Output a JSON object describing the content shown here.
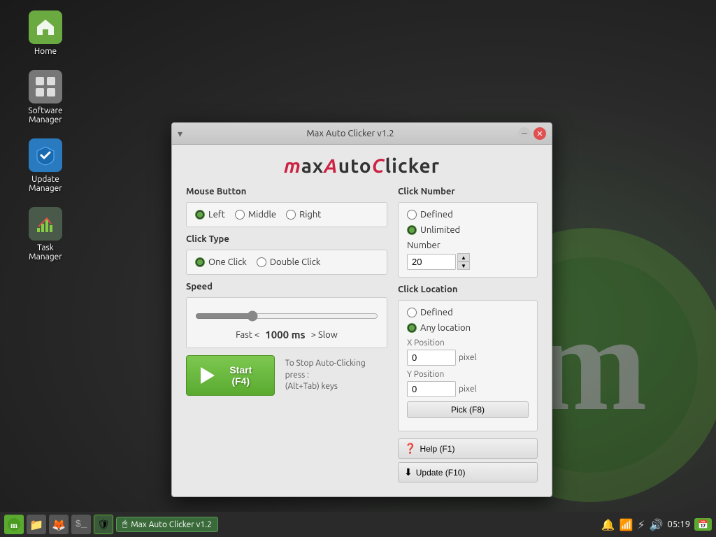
{
  "desktop": {
    "icons": [
      {
        "id": "home",
        "label": "Home",
        "icon_color": "#6aaa40",
        "icon_symbol": "🏠"
      },
      {
        "id": "software-manager",
        "label": "Software\nManager",
        "icon_color": "#888888",
        "icon_symbol": "⊞"
      },
      {
        "id": "update-manager",
        "label": "Update\nManager",
        "icon_color": "#2a7abf",
        "icon_symbol": "🛡"
      },
      {
        "id": "task-manager",
        "label": "Task\nManager",
        "icon_color": "#556655",
        "icon_symbol": "📊"
      }
    ]
  },
  "window": {
    "title": "Max Auto Clicker v1.2",
    "logo_text": "MaxAutoClicker",
    "sections": {
      "mouse_button": {
        "label": "Mouse Button",
        "options": [
          "Left",
          "Middle",
          "Right"
        ],
        "selected": "Left"
      },
      "click_type": {
        "label": "Click Type",
        "options": [
          "One Click",
          "Double Click"
        ],
        "selected": "One Click"
      },
      "speed": {
        "label": "Speed",
        "fast_label": "Fast <",
        "slow_label": "> Slow",
        "value": "1000 ms",
        "slider_value": 30
      },
      "click_number": {
        "label": "Click Number",
        "options": [
          "Defined",
          "Unlimited"
        ],
        "selected": "Unlimited",
        "number_label": "Number",
        "number_value": "20"
      },
      "click_location": {
        "label": "Click Location",
        "options": [
          "Defined",
          "Any location"
        ],
        "selected": "Any location",
        "x_label": "X Position",
        "y_label": "Y Position",
        "x_value": "0",
        "y_value": "0",
        "pixel_label": "pixel",
        "pick_btn": "Pick (F8)"
      }
    },
    "start_btn": "Start (F4)",
    "stop_hint_line1": "To Stop Auto-Clicking press :",
    "stop_hint_line2": "(Alt+Tab) keys",
    "help_btn": "Help (F1)",
    "update_btn": "Update (F10)"
  },
  "taskbar": {
    "open_window_label": "Max Auto Clicker v1.2",
    "time": "05:19",
    "notification_icon": "🔔",
    "wifi_icon": "📶",
    "power_icon": "⚡",
    "volume_icon": "🔊"
  }
}
